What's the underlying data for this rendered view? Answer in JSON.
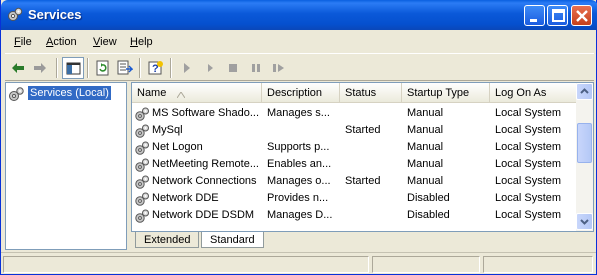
{
  "window": {
    "title": "Services"
  },
  "menu": [
    {
      "underline": "F",
      "rest": "ile"
    },
    {
      "underline": "A",
      "rest": "ction"
    },
    {
      "underline": "V",
      "rest": "iew"
    },
    {
      "underline": "H",
      "rest": "elp"
    }
  ],
  "tree": {
    "root_label": "Services (Local)"
  },
  "columns": {
    "name": "Name",
    "description": "Description",
    "status": "Status",
    "startup_type": "Startup Type",
    "log_on_as": "Log On As"
  },
  "rows": [
    {
      "name": "MS Software Shado...",
      "description": "Manages s...",
      "status": "",
      "startup": "Manual",
      "logon": "Local System"
    },
    {
      "name": "MySql",
      "description": "",
      "status": "Started",
      "startup": "Manual",
      "logon": "Local System"
    },
    {
      "name": "Net Logon",
      "description": "Supports p...",
      "status": "",
      "startup": "Manual",
      "logon": "Local System"
    },
    {
      "name": "NetMeeting Remote...",
      "description": "Enables an...",
      "status": "",
      "startup": "Manual",
      "logon": "Local System"
    },
    {
      "name": "Network Connections",
      "description": "Manages o...",
      "status": "Started",
      "startup": "Manual",
      "logon": "Local System"
    },
    {
      "name": "Network DDE",
      "description": "Provides n...",
      "status": "",
      "startup": "Disabled",
      "logon": "Local System"
    },
    {
      "name": "Network DDE DSDM",
      "description": "Manages D...",
      "status": "",
      "startup": "Disabled",
      "logon": "Local System"
    }
  ],
  "tabs": {
    "extended": "Extended",
    "standard": "Standard"
  },
  "colors": {
    "title_bar": "#0b59d9",
    "selection": "#316ac5",
    "chrome": "#ece9d8"
  },
  "icons": [
    "back-arrow-icon",
    "forward-arrow-icon",
    "show-hide-tree-icon",
    "refresh-icon",
    "export-list-icon",
    "help-icon",
    "play-icon",
    "play-small-icon",
    "stop-icon",
    "pause-icon",
    "restart-icon",
    "gear-icon"
  ]
}
